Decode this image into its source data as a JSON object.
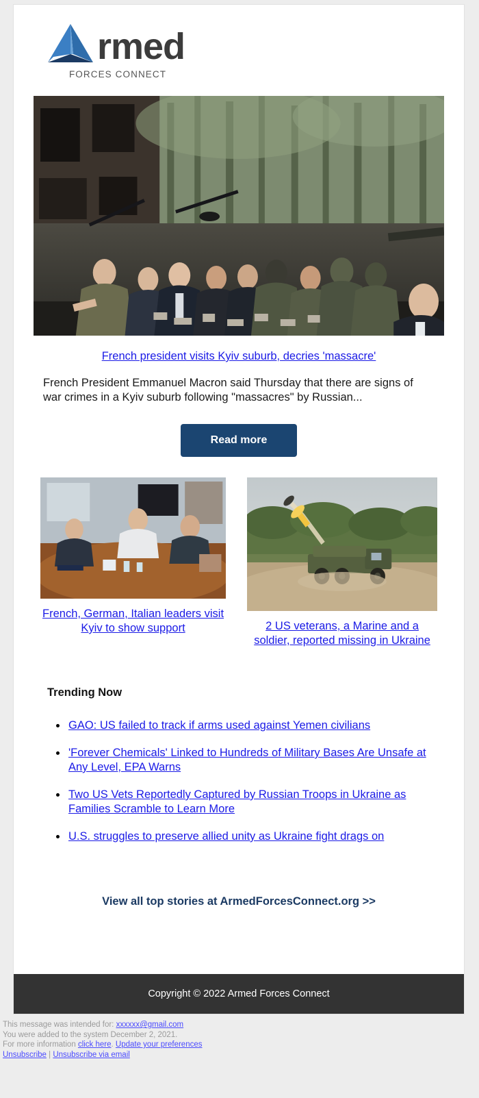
{
  "brand": {
    "logo_word": "rmed",
    "logo_sub": "FORCES CONNECT",
    "logo_mark_icon": "triangle-a-logo-icon",
    "color_light_blue": "#3b7fc4",
    "color_mid_blue": "#2f6dab",
    "color_dark_navy": "#1b3a63"
  },
  "hero": {
    "image_alt": "leaders-touring-war-damaged-street-photo",
    "headline": "French president visits Kyiv suburb, decries 'massacre'",
    "summary": "French President Emmanuel Macron said Thursday that there are signs of war crimes in a Kyiv suburb following \"massacres\" by Russian...",
    "button_label": "Read more",
    "button_color": "#1b4571"
  },
  "stories": [
    {
      "image_alt": "three-leaders-seated-at-conference-table-photo",
      "headline": "French, German, Italian leaders visit Kyiv to show support"
    },
    {
      "image_alt": "rocket-artillery-launcher-firing-photo",
      "headline": "2 US veterans, a Marine and a soldier, reported missing in Ukraine"
    }
  ],
  "trending": {
    "title": "Trending Now",
    "items": [
      "GAO: US failed to track if arms used against Yemen civilians",
      "'Forever Chemicals' Linked to Hundreds of Military Bases Are Unsafe at Any Level, EPA Warns",
      "Two US Vets Reportedly Captured by Russian Troops in Ukraine as Families Scramble to Learn More",
      "U.S. struggles to preserve allied unity as Ukraine fight drags on"
    ]
  },
  "cta": {
    "label": "View all top stories at ArmedForcesConnect.org >>"
  },
  "copyright": {
    "text": "Copyright © 2022 Armed Forces Connect"
  },
  "legal": {
    "line1_prefix": "This message was intended for: ",
    "line1_email": "xxxxxx@gmail.com",
    "line2": "You were added to the system December 2, 2021.",
    "line3_prefix": "For more information ",
    "line3_link1": "click here",
    "line3_middle": ". ",
    "line3_link2": "Update your preferences",
    "line4_link1": "Unsubscribe",
    "line4_sep": " | ",
    "line4_link2": "Unsubscribe via email"
  },
  "colors": {
    "link_blue": "#1a1ae6",
    "page_background": "#ededed",
    "card_background": "#ffffff",
    "footer_bar": "#333333"
  }
}
